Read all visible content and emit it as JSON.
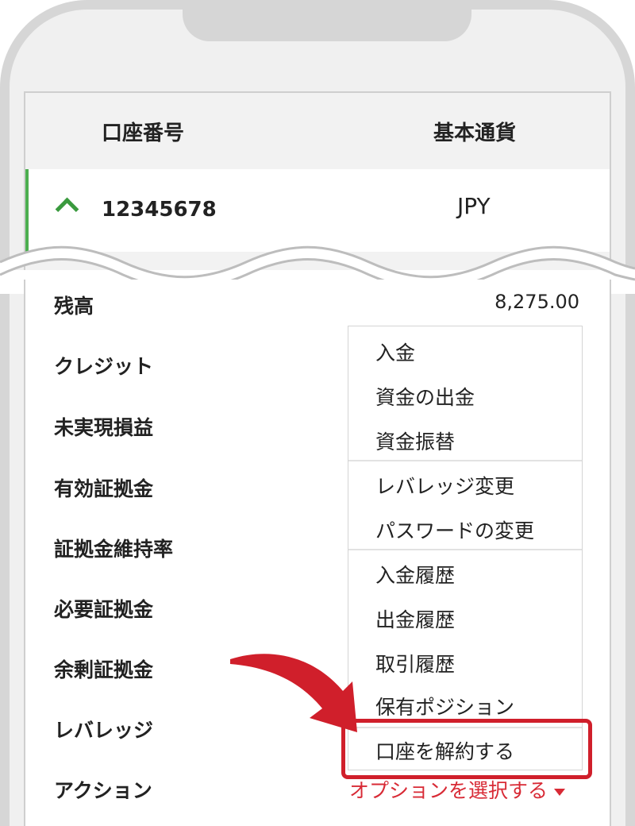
{
  "table": {
    "col_account": "口座番号",
    "col_currency": "基本通貨",
    "account_number": "12345678",
    "account_currency": "JPY"
  },
  "details": {
    "balance_label": "残高",
    "balance_value": "8,275.00",
    "credit_label": "クレジット",
    "unrealized_label": "未実現損益",
    "equity_label": "有効証拠金",
    "margin_level_label": "証拠金維持率",
    "required_margin_label": "必要証拠金",
    "free_margin_label": "余剰証拠金",
    "leverage_label": "レバレッジ",
    "action_label": "アクション",
    "action_select_text": "オプションを選択する"
  },
  "menu": {
    "items": [
      "入金",
      "資金の出金",
      "資金振替",
      "レバレッジ変更",
      "パスワードの変更",
      "入金履歴",
      "出金履歴",
      "取引履歴",
      "保有ポジション",
      "口座を解約する"
    ]
  },
  "colors": {
    "accent_green": "#4cae4f",
    "highlight_red": "#d01f2b"
  }
}
